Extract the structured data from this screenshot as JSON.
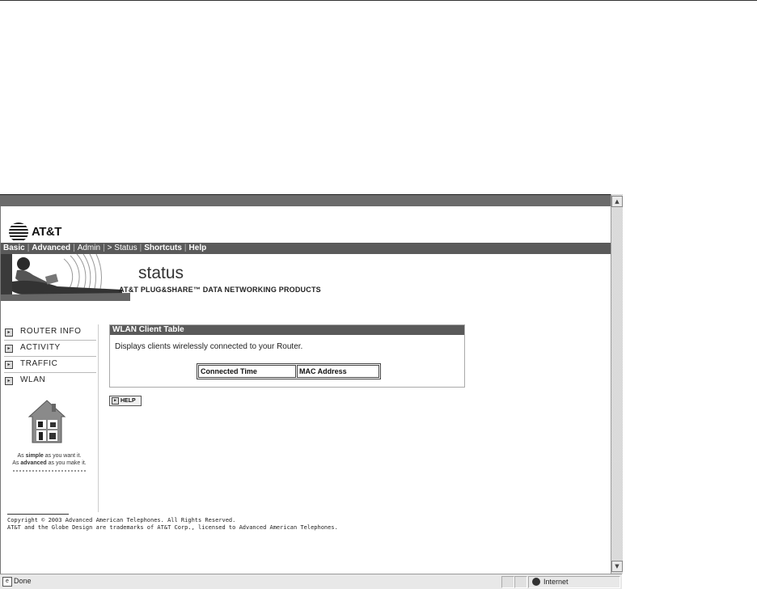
{
  "page": {
    "brand": "AT&T",
    "nav": [
      {
        "label": "Basic",
        "bold": true
      },
      {
        "label": "Advanced",
        "bold": true
      },
      {
        "label": "Admin",
        "bold": false
      },
      {
        "label": "> Status",
        "bold": false
      },
      {
        "label": "Shortcuts",
        "bold": true
      },
      {
        "label": "Help",
        "bold": true
      }
    ],
    "banner_title": "status",
    "banner_subtitle": "AT&T PLUG&SHARE™ DATA NETWORKING PRODUCTS",
    "sidebar": [
      {
        "label": "ROUTER INFO"
      },
      {
        "label": "ACTIVITY"
      },
      {
        "label": "TRAFFIC"
      },
      {
        "label": "WLAN"
      }
    ],
    "tagline": {
      "line1_pre": "As ",
      "line1_bold": "simple",
      "line1_post": " as you want it.",
      "line2_pre": "As ",
      "line2_bold": "advanced",
      "line2_post": " as you make it."
    },
    "panel": {
      "title": "WLAN Client Table",
      "description": "Displays clients wirelessly connected to your Router.",
      "columns": [
        "Connected Time",
        "MAC Address"
      ]
    },
    "help_label": "HELP",
    "footer": {
      "line1": "Copyright © 2003 Advanced American Telephones. All Rights Reserved.",
      "line2": "AT&T and the Globe Design are trademarks of AT&T Corp., licensed to Advanced American Telephones."
    }
  },
  "statusbar": {
    "text": "Done",
    "zone": "Internet"
  },
  "colors": {
    "nav_bg": "#5a5a5a",
    "panel_header_bg": "#5a5a5a"
  }
}
